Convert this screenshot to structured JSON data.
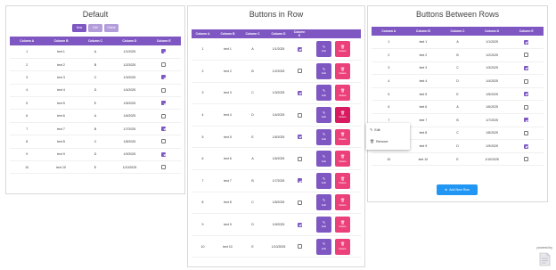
{
  "panels": {
    "default": {
      "title": "Default",
      "toolbar": {
        "new": "New",
        "edit": "Edit",
        "delete": "Delete"
      }
    },
    "row_buttons": {
      "title": "Buttons in Row",
      "edit": "Edit",
      "delete": "Delete"
    },
    "between_rows": {
      "title": "Buttons Between Rows",
      "add_new_row": "Add New Row"
    }
  },
  "columns": [
    "Column A",
    "Column B",
    "Column C",
    "Column D",
    "Column E"
  ],
  "rows": [
    {
      "a": "1",
      "b": "text 1",
      "c": "A",
      "d": "1/1/2025",
      "e": true
    },
    {
      "a": "2",
      "b": "text 2",
      "c": "B",
      "d": "1/2/2025",
      "e": false
    },
    {
      "a": "3",
      "b": "text 3",
      "c": "C",
      "d": "1/3/2025",
      "e": true
    },
    {
      "a": "4",
      "b": "text 4",
      "c": "D",
      "d": "1/4/2025",
      "e": false
    },
    {
      "a": "5",
      "b": "text 5",
      "c": "E",
      "d": "1/5/2025",
      "e": true
    },
    {
      "a": "6",
      "b": "text 6",
      "c": "A",
      "d": "1/6/2025",
      "e": false
    },
    {
      "a": "7",
      "b": "text 7",
      "c": "B",
      "d": "1/7/2025",
      "e": true
    },
    {
      "a": "8",
      "b": "text 8",
      "c": "C",
      "d": "1/8/2025",
      "e": false
    },
    {
      "a": "9",
      "b": "text 9",
      "c": "D",
      "d": "1/9/2025",
      "e": true
    },
    {
      "a": "10",
      "b": "text 10",
      "c": "E",
      "d": "1/10/2025",
      "e": false
    }
  ],
  "context_menu": {
    "edit": "Edit",
    "remove": "Remove"
  },
  "footer": {
    "powered_by": "powered by"
  },
  "icons": {
    "edit": "pencil-icon",
    "delete": "trash-icon",
    "add": "plus-circle-icon",
    "remove": "trash-icon"
  },
  "colors": {
    "primary": "#7e57c2",
    "danger": "#ec407a",
    "add": "#2196f3"
  }
}
